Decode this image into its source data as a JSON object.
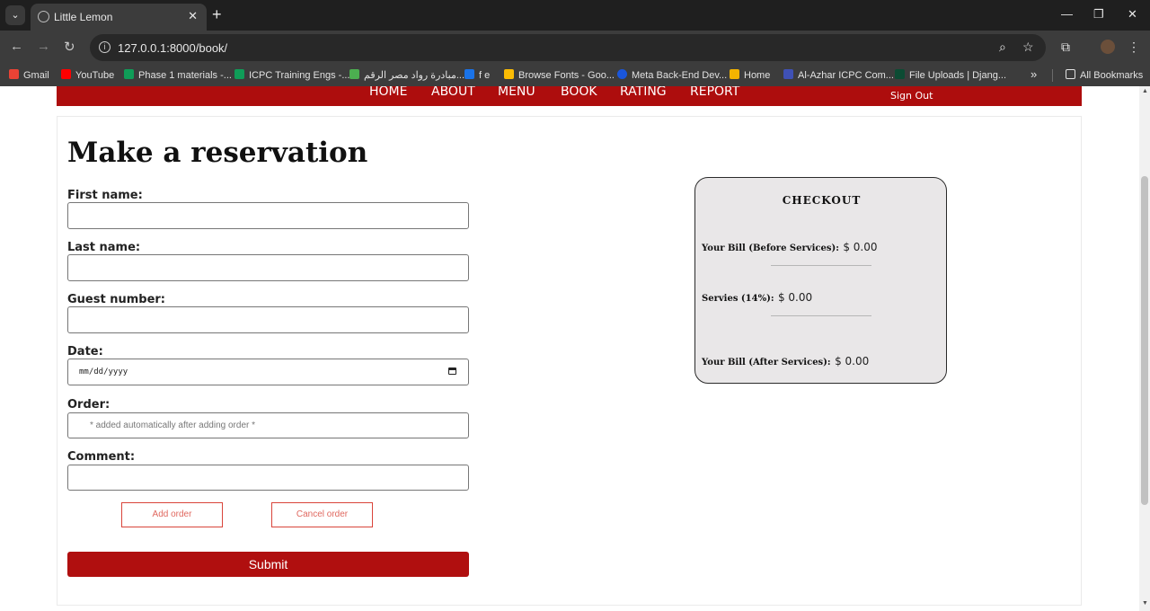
{
  "browser": {
    "tab_title": "Little Lemon",
    "tab_close": "✕",
    "new_tab": "+",
    "url": "127.0.0.1:8000/book/",
    "window_controls": {
      "minimize": "—",
      "restore": "❐",
      "close": "✕"
    },
    "nav": {
      "back": "←",
      "forward": "→",
      "reload": "↻"
    },
    "bookmarks": [
      {
        "label": "Gmail",
        "color": "#ea4335"
      },
      {
        "label": "YouTube",
        "color": "#ff0000"
      },
      {
        "label": "Phase 1 materials -...",
        "color": "#0f9d58"
      },
      {
        "label": "ICPC Training Engs -...",
        "color": "#0f9d58"
      },
      {
        "label": "مبادرة رواد مصر الرقم...",
        "color": "#4caf50"
      },
      {
        "label": "f e",
        "color": "#1a73e8"
      },
      {
        "label": "Browse Fonts - Goo...",
        "color": "#fbbc04"
      },
      {
        "label": "Meta Back-End Dev...",
        "color": "#1a56db"
      },
      {
        "label": "Home",
        "color": "#f4b400"
      },
      {
        "label": "Al-Azhar ICPC Com...",
        "color": "#3f51b5"
      },
      {
        "label": "File Uploads | Djang...",
        "color": "#0c4b33"
      }
    ],
    "more_bookmarks": "»",
    "all_bookmarks": "All Bookmarks"
  },
  "navbar": {
    "links": [
      "HOME",
      "ABOUT",
      "MENU",
      "BOOK",
      "RATING",
      "REPORT"
    ],
    "sign_out": "Sign Out"
  },
  "form": {
    "heading": "Make a reservation",
    "first_name_label": "First name:",
    "last_name_label": "Last name:",
    "guest_number_label": "Guest number:",
    "date_label": "Date:",
    "date_placeholder": "mm/dd/yyyy",
    "order_label": "Order:",
    "order_placeholder": "* added automatically after adding order *",
    "comment_label": "Comment:",
    "add_order": "Add order",
    "cancel_order": "Cancel order",
    "submit": "Submit"
  },
  "checkout": {
    "title": "CHECKOUT",
    "before_label": "Your Bill (Before Services):",
    "before_value": "$ 0.00",
    "services_label": "Servies (14%):",
    "services_value": "$ 0.00",
    "after_label": "Your Bill (After Services):",
    "after_value": "$ 0.00"
  }
}
